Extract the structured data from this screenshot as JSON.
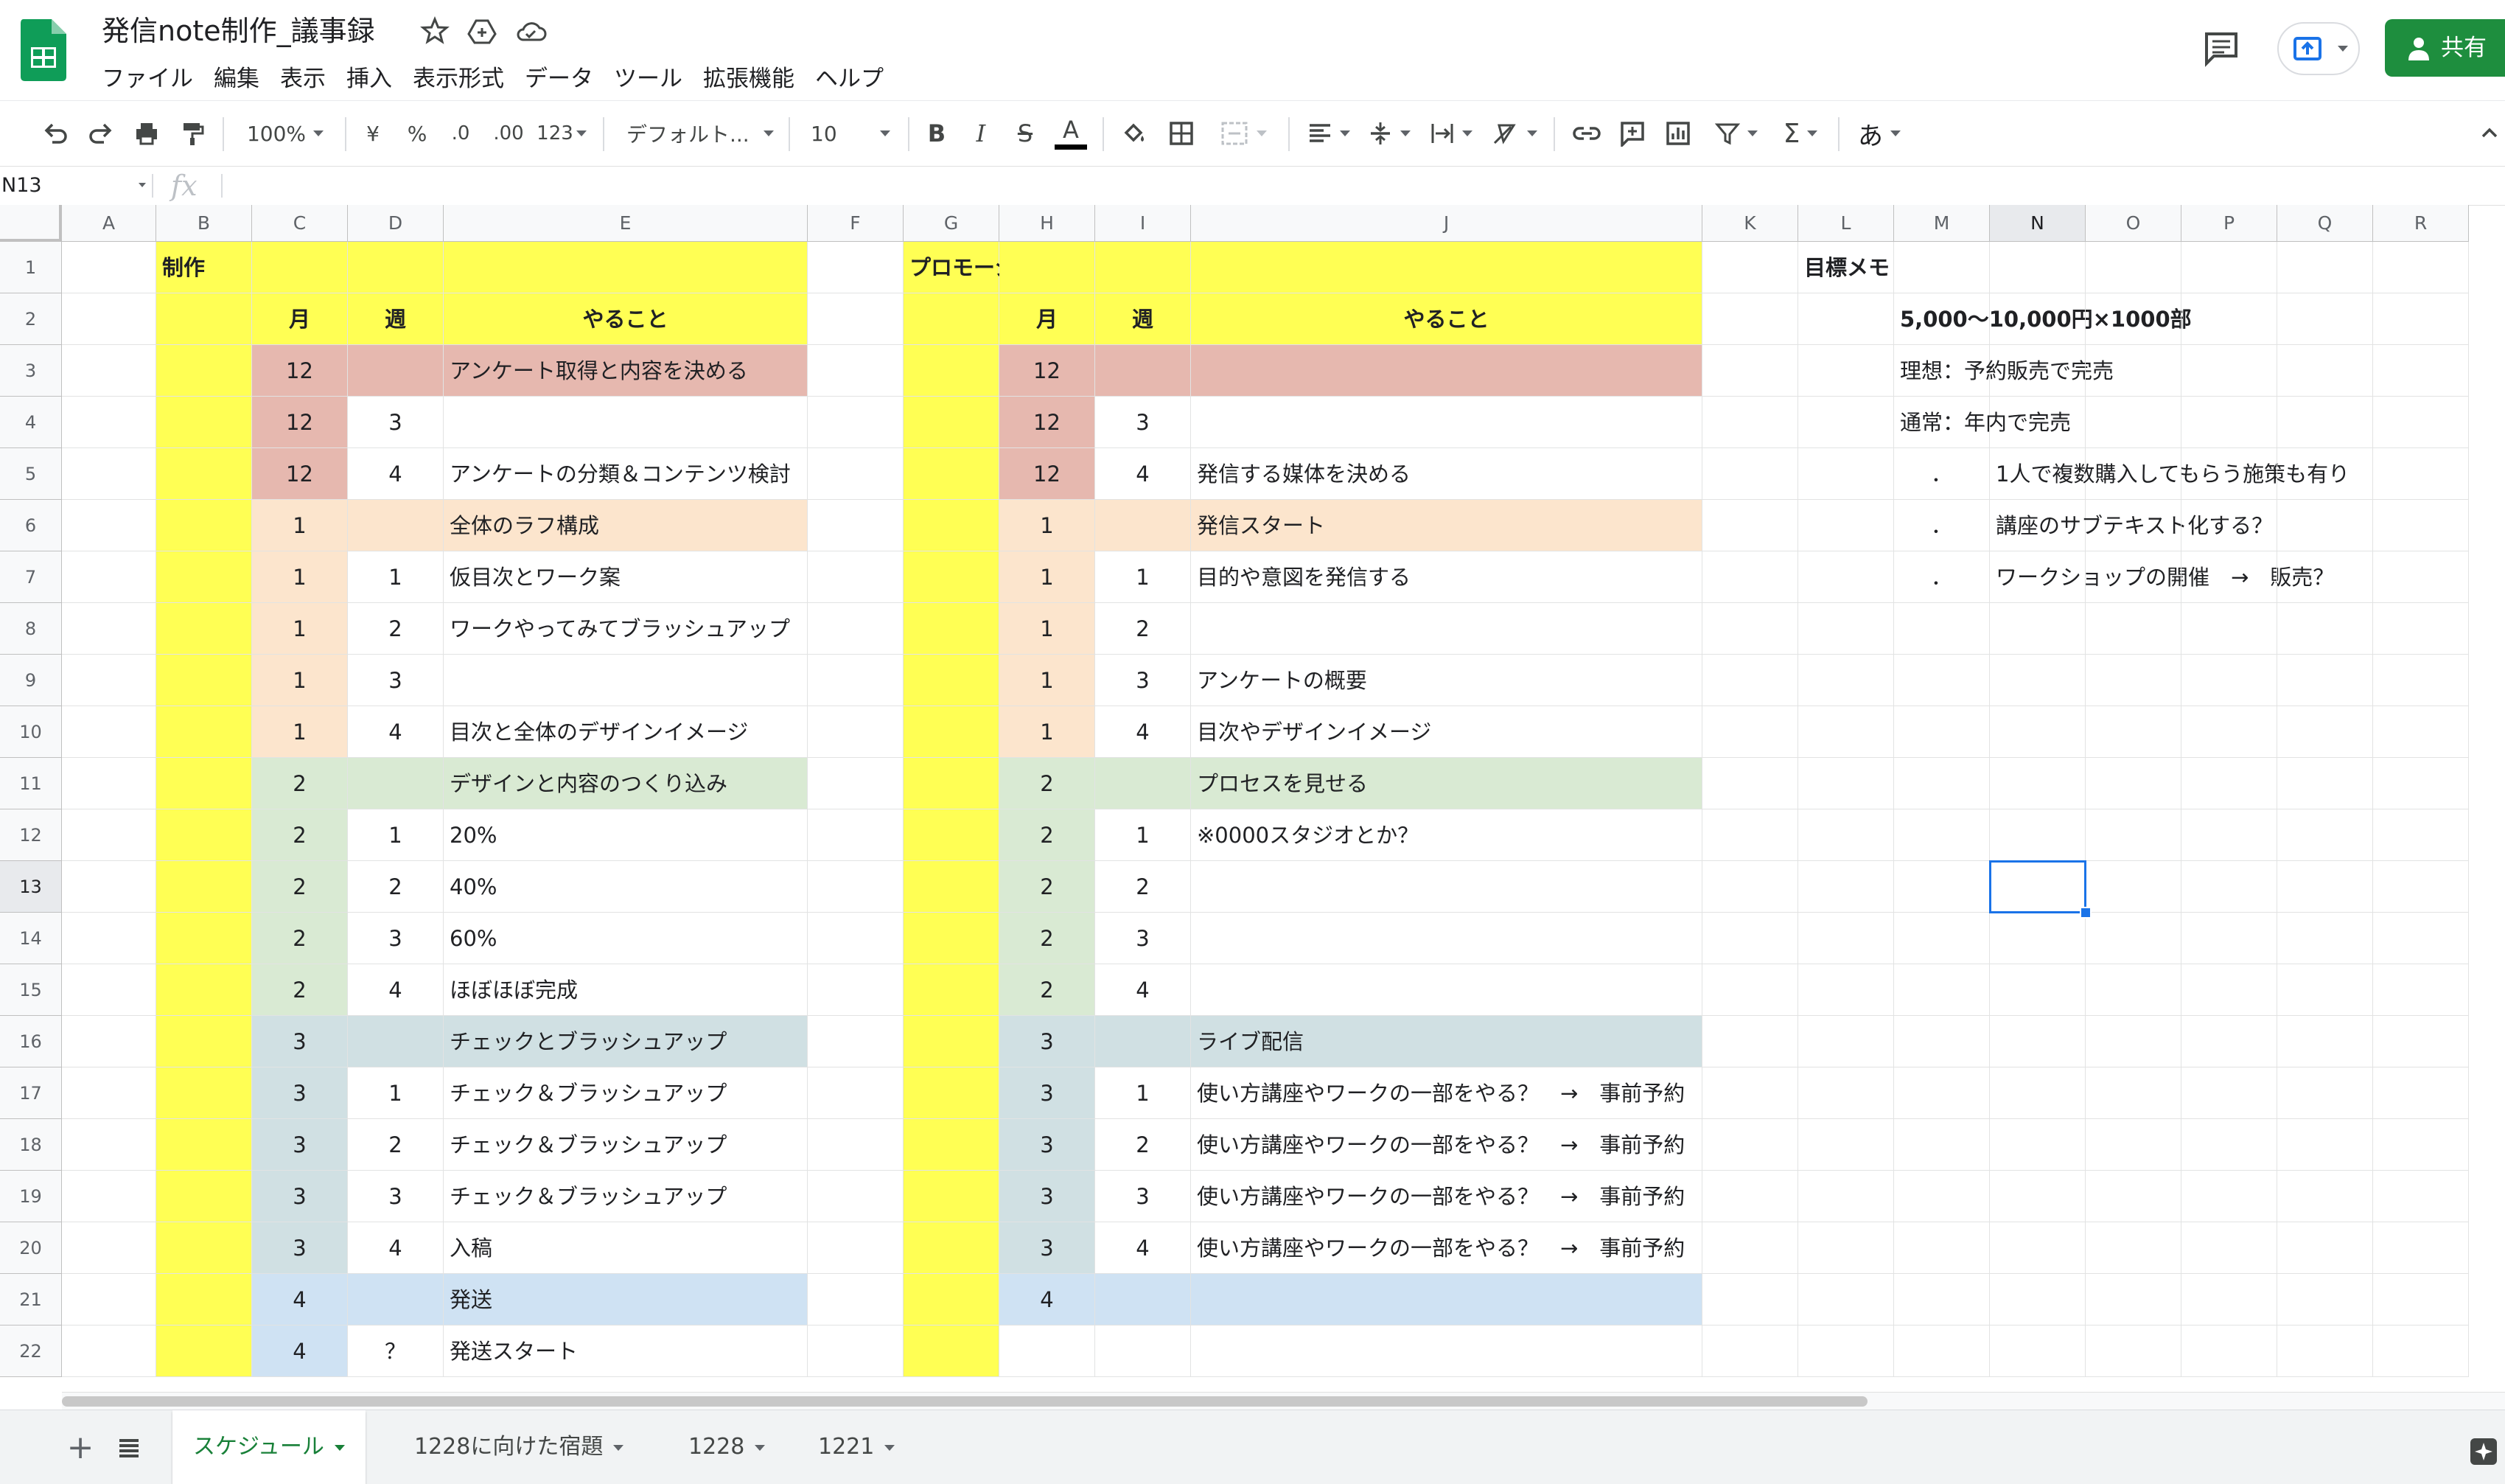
{
  "app": {
    "doc_title": "発信note制作_議事録",
    "menu": [
      "ファイル",
      "編集",
      "表示",
      "挿入",
      "表示形式",
      "データ",
      "ツール",
      "拡張機能",
      "ヘルプ"
    ],
    "share_label": "共有"
  },
  "toolbar": {
    "zoom": "100%",
    "currency": "¥",
    "percent": "%",
    "dec_decrease": ".0",
    "dec_increase": ".00",
    "more_formats": "123",
    "font": "デフォルト...",
    "font_size": "10",
    "bold": "B",
    "italic": "I",
    "strike": "S",
    "text_color": "A",
    "input_tools": "あ"
  },
  "formula_bar": {
    "name_box": "N13",
    "fx": "fx",
    "value": ""
  },
  "columns": [
    "A",
    "B",
    "C",
    "D",
    "E",
    "F",
    "G",
    "H",
    "I",
    "J",
    "K",
    "L",
    "M",
    "N",
    "O",
    "P",
    "Q",
    "R"
  ],
  "selected_cell": "N13",
  "rows": [
    {
      "n": "1",
      "B": "制作",
      "G": "プロモーション",
      "L": "目標メモ"
    },
    {
      "n": "2",
      "C": "月",
      "D": "週",
      "E": "やること",
      "H": "月",
      "I": "週",
      "J": "やること",
      "M": "5,000〜10,000円×1000部"
    },
    {
      "n": "3",
      "C": "12",
      "E": "アンケート取得と内容を決める",
      "H": "12",
      "M": "理想：予約販売で完売"
    },
    {
      "n": "4",
      "C": "12",
      "D": "3",
      "H": "12",
      "I": "3",
      "M": "通常：年内で完売"
    },
    {
      "n": "5",
      "C": "12",
      "D": "4",
      "E": "アンケートの分類＆コンテンツ検討",
      "H": "12",
      "I": "4",
      "J": "発信する媒体を決める",
      "M": "．",
      "N": "1人で複数購入してもらう施策も有り"
    },
    {
      "n": "6",
      "C": "1",
      "E": "全体のラフ構成",
      "H": "1",
      "J": "発信スタート",
      "M": "．",
      "N": "講座のサブテキスト化する？"
    },
    {
      "n": "7",
      "C": "1",
      "D": "1",
      "E": "仮目次とワーク案",
      "H": "1",
      "I": "1",
      "J": "目的や意図を発信する",
      "M": "．",
      "N": "ワークショップの開催　→　販売？"
    },
    {
      "n": "8",
      "C": "1",
      "D": "2",
      "E": "ワークやってみてブラッシュアップ",
      "H": "1",
      "I": "2"
    },
    {
      "n": "9",
      "C": "1",
      "D": "3",
      "H": "1",
      "I": "3",
      "J": "アンケートの概要"
    },
    {
      "n": "10",
      "C": "1",
      "D": "4",
      "E": "目次と全体のデザインイメージ",
      "H": "1",
      "I": "4",
      "J": "目次やデザインイメージ"
    },
    {
      "n": "11",
      "C": "2",
      "E": "デザインと内容のつくり込み",
      "H": "2",
      "J": "プロセスを見せる"
    },
    {
      "n": "12",
      "C": "2",
      "D": "1",
      "E": "20%",
      "H": "2",
      "I": "1",
      "J": "※0000スタジオとか？"
    },
    {
      "n": "13",
      "C": "2",
      "D": "2",
      "E": "40%",
      "H": "2",
      "I": "2"
    },
    {
      "n": "14",
      "C": "2",
      "D": "3",
      "E": "60%",
      "H": "2",
      "I": "3"
    },
    {
      "n": "15",
      "C": "2",
      "D": "4",
      "E": "ほぼほぼ完成",
      "H": "2",
      "I": "4"
    },
    {
      "n": "16",
      "C": "3",
      "E": "チェックとブラッシュアップ",
      "H": "3",
      "J": "ライブ配信"
    },
    {
      "n": "17",
      "C": "3",
      "D": "1",
      "E": "チェック＆ブラッシュアップ",
      "H": "3",
      "I": "1",
      "J": "使い方講座やワークの一部をやる？　→　事前予約"
    },
    {
      "n": "18",
      "C": "3",
      "D": "2",
      "E": "チェック＆ブラッシュアップ",
      "H": "3",
      "I": "2",
      "J": "使い方講座やワークの一部をやる？　→　事前予約"
    },
    {
      "n": "19",
      "C": "3",
      "D": "3",
      "E": "チェック＆ブラッシュアップ",
      "H": "3",
      "I": "3",
      "J": "使い方講座やワークの一部をやる？　→　事前予約"
    },
    {
      "n": "20",
      "C": "3",
      "D": "4",
      "E": "入稿",
      "H": "3",
      "I": "4",
      "J": "使い方講座やワークの一部をやる？　→　事前予約"
    },
    {
      "n": "21",
      "C": "4",
      "E": "発送",
      "H": "4"
    },
    {
      "n": "22",
      "C": "4",
      "D": "？",
      "E": "発送スタート"
    }
  ],
  "sheet_tabs": [
    {
      "label": "スケジュール",
      "active": true
    },
    {
      "label": "1228に向けた宿題",
      "active": false
    },
    {
      "label": "1228",
      "active": false
    },
    {
      "label": "1221",
      "active": false
    }
  ],
  "colors": {
    "yellow": "#ffff54",
    "month12": "#e6b8af",
    "month1": "#fce5cd",
    "month2": "#d9ead3",
    "month3": "#d0e0e3",
    "month4": "#cfe2f3",
    "accent_green": "#1e8e3e",
    "selection_blue": "#1a73e8"
  }
}
